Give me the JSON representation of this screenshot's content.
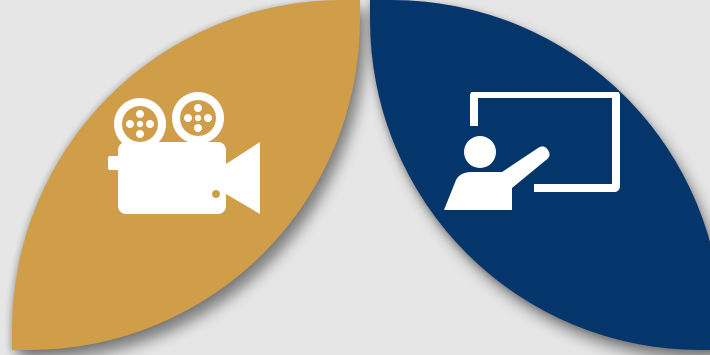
{
  "colors": {
    "background": "#e6e6e6",
    "tile_left": "#d09d49",
    "tile_right": "#04366b",
    "icon": "#ffffff"
  },
  "tiles": [
    {
      "icon": "video-camera-icon"
    },
    {
      "icon": "teacher-presentation-icon"
    }
  ]
}
